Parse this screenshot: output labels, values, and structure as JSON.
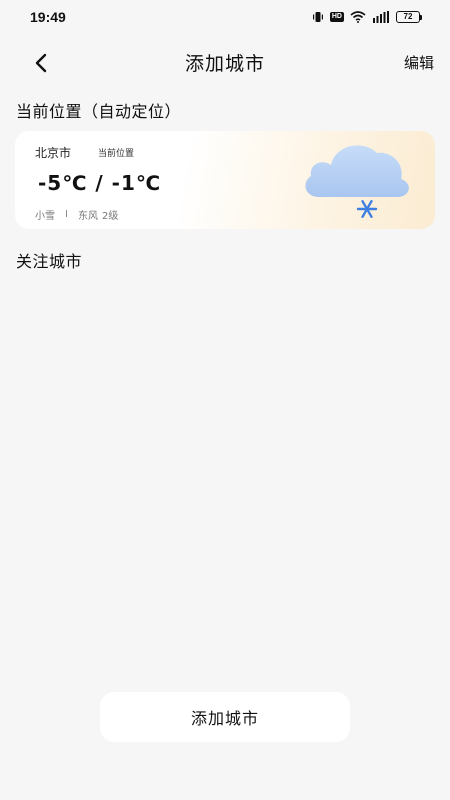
{
  "status_bar": {
    "time": "19:49",
    "hd_label": "HD",
    "battery_level": "72",
    "icons": [
      "vibrate-icon",
      "hd-icon",
      "wifi-icon",
      "signal-icon",
      "battery-icon"
    ]
  },
  "header": {
    "back_icon": "chevron-left-icon",
    "title": "添加城市",
    "edit_label": "编辑"
  },
  "current_section": {
    "title": "当前位置（自动定位）"
  },
  "weather_card": {
    "city": "北京市",
    "badge": "当前位置",
    "temperature": "-5℃  /  -1℃",
    "condition": "小雪",
    "separator": "I",
    "wind_direction": "东风",
    "wind_level": "2级",
    "icon": "cloud-snow-icon",
    "colors": {
      "cloud": "#b9d2f5",
      "snowflake": "#3f7fe0",
      "card_gradient_end": "#fbecd2"
    }
  },
  "followed_section": {
    "title": "关注城市"
  },
  "bottom": {
    "add_city_label": "添加城市"
  }
}
